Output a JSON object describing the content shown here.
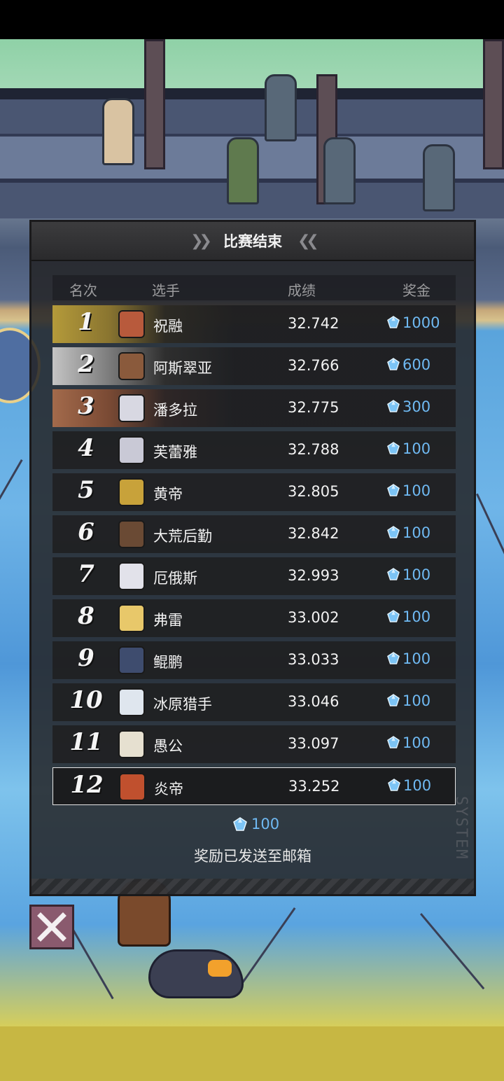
{
  "panel": {
    "title": "比赛结束",
    "columns": {
      "rank": "名次",
      "player": "选手",
      "score": "成绩",
      "prize": "奖金"
    },
    "rows": [
      {
        "rank": "1",
        "name": "祝融",
        "score": "32.742",
        "prize": "1000",
        "tier": "gold",
        "avatar_color": "#b85a3c"
      },
      {
        "rank": "2",
        "name": "阿斯翠亚",
        "score": "32.766",
        "prize": "600",
        "tier": "silver",
        "avatar_color": "#8a5a3c"
      },
      {
        "rank": "3",
        "name": "潘多拉",
        "score": "32.775",
        "prize": "300",
        "tier": "bronze",
        "avatar_color": "#d8d8e2"
      },
      {
        "rank": "4",
        "name": "芙蕾雅",
        "score": "32.788",
        "prize": "100",
        "tier": "normal",
        "avatar_color": "#c9c9d6"
      },
      {
        "rank": "5",
        "name": "黄帝",
        "score": "32.805",
        "prize": "100",
        "tier": "normal",
        "avatar_color": "#c8a23a"
      },
      {
        "rank": "6",
        "name": "大荒后勤",
        "score": "32.842",
        "prize": "100",
        "tier": "normal",
        "avatar_color": "#6a4a34"
      },
      {
        "rank": "7",
        "name": "厄俄斯",
        "score": "32.993",
        "prize": "100",
        "tier": "normal",
        "avatar_color": "#e2e2ea"
      },
      {
        "rank": "8",
        "name": "弗雷",
        "score": "33.002",
        "prize": "100",
        "tier": "normal",
        "avatar_color": "#e8c86a"
      },
      {
        "rank": "9",
        "name": "鲲鹏",
        "score": "33.033",
        "prize": "100",
        "tier": "normal",
        "avatar_color": "#3e4c6e"
      },
      {
        "rank": "10",
        "name": "冰原猎手",
        "score": "33.046",
        "prize": "100",
        "tier": "normal",
        "avatar_color": "#dfe6ee"
      },
      {
        "rank": "11",
        "name": "愚公",
        "score": "33.097",
        "prize": "100",
        "tier": "normal",
        "avatar_color": "#e6e0d0"
      },
      {
        "rank": "12",
        "name": "炎帝",
        "score": "33.252",
        "prize": "100",
        "tier": "self",
        "avatar_color": "#c0502e"
      }
    ],
    "reward_amount": "100",
    "reward_message": "奖励已发送至邮箱",
    "watermark": "SYSTEM"
  },
  "colors": {
    "prize_text": "#6fb9f2",
    "gem": "#7cc4f5"
  },
  "icons": {
    "currency": "crystal-gem-icon",
    "close": "close-x-icon"
  }
}
